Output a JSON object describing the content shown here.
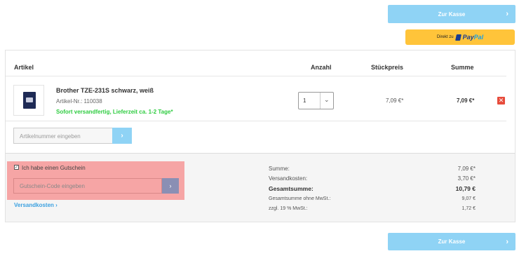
{
  "header_buttons": {
    "checkout_label": "Zur Kasse",
    "paypal_prefix": "Direkt zu",
    "paypal_brand_1": "Pay",
    "paypal_brand_2": "Pal"
  },
  "cart": {
    "columns": {
      "article": "Artikel",
      "quantity": "Anzahl",
      "unit_price": "Stückpreis",
      "total": "Summe"
    },
    "items": [
      {
        "name": "Brother TZE-231S schwarz, weiß",
        "article_no": "Artikel-Nr.: 110038",
        "availability": "Sofort versandfertig, Lieferzeit ca. 1-2 Tage*",
        "quantity": "1",
        "unit_price": "7,09 €*",
        "total": "7,09 €*",
        "delete_symbol": "✕"
      }
    ],
    "add_article": {
      "placeholder": "Artikelnummer eingeben",
      "button_symbol": "›"
    }
  },
  "voucher": {
    "checkbox_label": "Ich habe einen Gutschein",
    "placeholder": "Gutschein-Code eingeben",
    "button_symbol": "›",
    "shipping_link": "Versandkosten ›"
  },
  "summary": {
    "rows": [
      {
        "label": "Summe:",
        "value": "7,09 €*"
      },
      {
        "label": "Versandkosten:",
        "value": "3,70 €*"
      },
      {
        "label": "Gesamtsumme:",
        "value": "10,79 €"
      },
      {
        "label": "Gesamtsumme ohne MwSt.:",
        "value": "9,07 €"
      },
      {
        "label": "zzgl. 19 % MwSt.:",
        "value": "1,72 €"
      }
    ]
  },
  "footer_buttons": {
    "checkout_label": "Zur Kasse"
  },
  "colors": {
    "checkout_blue": "#8fd3f5",
    "paypal_yellow": "#ffc43a",
    "availability_green": "#2ecc40",
    "voucher_highlight": "#f6a5a5",
    "delete_red": "#e74c3c"
  }
}
